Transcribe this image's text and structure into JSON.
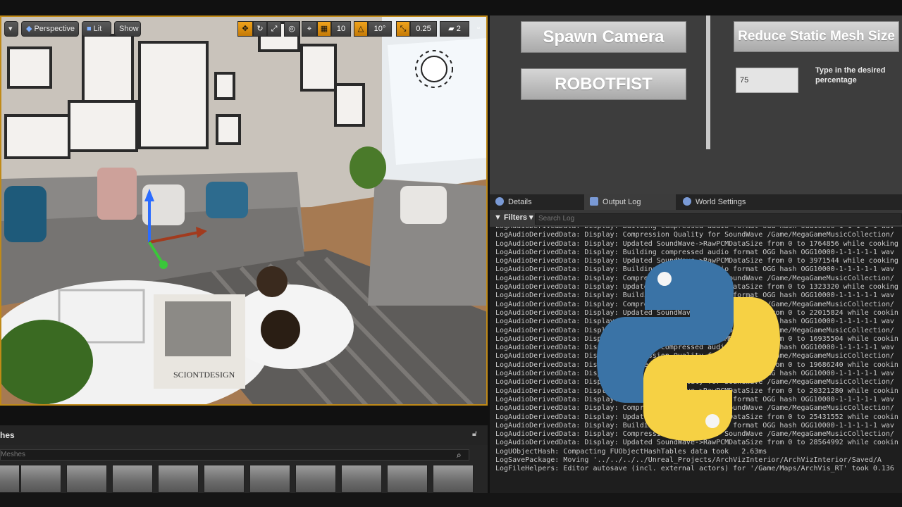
{
  "viewport": {
    "menu_icon": "caret-down-icon",
    "perspective_label": "Perspective",
    "lit_label": "Lit",
    "show_label": "Show",
    "grid_snap_value": "10",
    "rotation_snap_value": "10°",
    "scale_snap_value": "0.25",
    "camera_speed_value": "2",
    "book_title": "SCIONTDESIGN"
  },
  "tool_panel": {
    "spawn_camera_label": "Spawn Camera",
    "robotfist_label": "ROBOTFIST",
    "reduce_mesh_label": "Reduce Static Mesh Size",
    "percentage_value": "75",
    "percentage_hint": "Type in the desired percentage"
  },
  "tabs": [
    {
      "label": "Details",
      "icon": "info-icon"
    },
    {
      "label": "Output Log",
      "icon": "log-icon"
    },
    {
      "label": "World Settings",
      "icon": "globe-icon"
    }
  ],
  "filter_bar": {
    "filters_label": "Filters",
    "search_placeholder": "Search Log"
  },
  "log_lines": [
    "LogAudioDerivedData: Display: Building compressed audio format OGG hash OGG10000-1-1-1-1-1 wav",
    "LogAudioDerivedData: Display: Compression Quality for SoundWave /Game/MegaGameMusicCollection/",
    "LogAudioDerivedData: Display: Updated SoundWave->RawPCMDataSize from 0 to 1764856 while cooking",
    "LogAudioDerivedData: Display: Building compressed audio format OGG hash OGG10000-1-1-1-1-1 wav",
    "LogAudioDerivedData: Display: Updated SoundWave->RawPCMDataSize from 0 to 3971544 while cooking",
    "LogAudioDerivedData: Display: Building compressed audio format OGG hash OGG10000-1-1-1-1-1 wav",
    "LogAudioDerivedData: Display: Compression Quality for SoundWave /Game/MegaGameMusicCollection/",
    "LogAudioDerivedData: Display: Updated SoundWave->RawPCMDataSize from 0 to 1323320 while cooking",
    "LogAudioDerivedData: Display: Building compressed audio format OGG hash OGG10000-1-1-1-1-1 wav",
    "LogAudioDerivedData: Display: Compression Quality for SoundWave /Game/MegaGameMusicCollection/",
    "LogAudioDerivedData: Display: Updated SoundWave->RawPCMDataSize from 0 to 22015824 while cookin",
    "LogAudioDerivedData: Display: Building compressed audio format OGG hash OGG10000-1-1-1-1-1 wav",
    "LogAudioDerivedData: Display: Compression Quality for SoundWave /Game/MegaGameMusicCollection/",
    "LogAudioDerivedData: Display: Updated SoundWave->RawPCMDataSize from 0 to 16935504 while cookin",
    "LogAudioDerivedData: Display: Building compressed audio format OGG hash OGG10000-1-1-1-1-1 wav",
    "LogAudioDerivedData: Display: Compression Quality for SoundWave /Game/MegaGameMusicCollection/",
    "LogAudioDerivedData: Display: Updated SoundWave->RawPCMDataSize from 0 to 19686240 while cookin",
    "LogAudioDerivedData: Display: Building compressed audio format OGG hash OGG10000-1-1-1-1-1 wav",
    "LogAudioDerivedData: Display: Compression Quality for SoundWave /Game/MegaGameMusicCollection/",
    "LogAudioDerivedData: Display: Updated SoundWave->RawPCMDataSize from 0 to 20321280 while cookin",
    "LogAudioDerivedData: Display: Building compressed audio format OGG hash OGG10000-1-1-1-1-1 wav",
    "LogAudioDerivedData: Display: Compression Quality for SoundWave /Game/MegaGameMusicCollection/",
    "LogAudioDerivedData: Display: Updated SoundWave->RawPCMDataSize from 0 to 25431552 while cookin",
    "LogAudioDerivedData: Display: Building compressed audio format OGG hash OGG10000-1-1-1-1-1 wav",
    "LogAudioDerivedData: Display: Compression Quality for SoundWave /Game/MegaGameMusicCollection/",
    "LogAudioDerivedData: Display: Updated SoundWave->RawPCMDataSize from 0 to 28564992 while cookin",
    "LogUObjectHash: Compacting FUObjectHashTables data took   2.63ms",
    "LogSavePackage: Moving '../../../../Unreal_Projects/ArchVizInterior/ArchVizInterior/Saved/A",
    "LogFileHelpers: Editor autosave (incl. external actors) for '/Game/Maps/ArchVis_RT' took 0.136"
  ],
  "content_browser": {
    "title": "hes",
    "search_placeholder": "Meshes",
    "lock_icon": "lock-icon",
    "search_icon": "magnifier-icon"
  }
}
